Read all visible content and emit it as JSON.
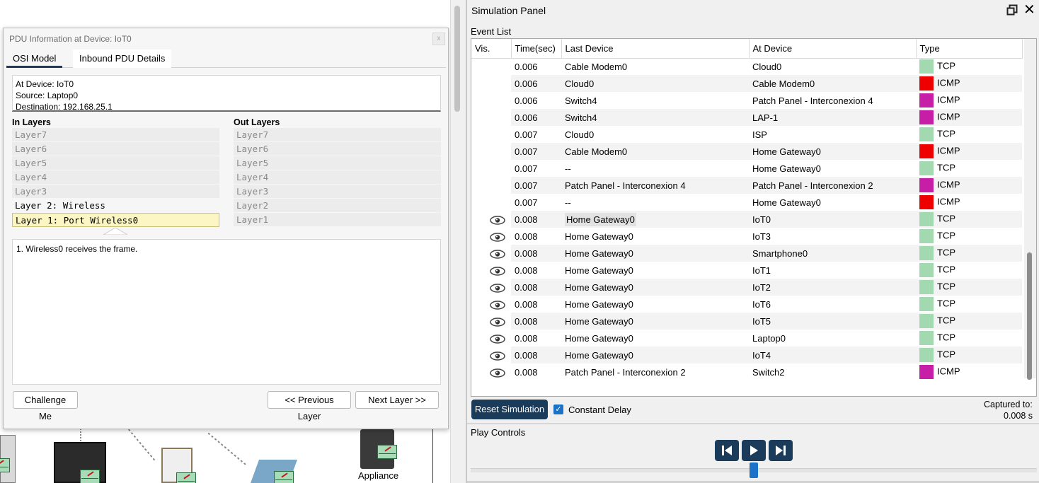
{
  "workspace": {
    "device_label": "Appliance"
  },
  "pdu": {
    "title": "PDU Information at Device: IoT0",
    "close_label": "x",
    "tabs": [
      {
        "label": "OSI Model",
        "active": true
      },
      {
        "label": "Inbound PDU Details",
        "active": false
      }
    ],
    "info": {
      "at_device": "At Device: IoT0",
      "source": "Source: Laptop0",
      "destination": "Destination: 192.168.25.1"
    },
    "in_layers_title": "In Layers",
    "out_layers_title": "Out Layers",
    "in_layers": [
      "Layer7",
      "Layer6",
      "Layer5",
      "Layer4",
      "Layer3",
      "Layer 2: Wireless",
      "Layer 1: Port Wireless0"
    ],
    "out_layers": [
      "Layer7",
      "Layer6",
      "Layer5",
      "Layer4",
      "Layer3",
      "Layer2",
      "Layer1"
    ],
    "description": "1. Wireless0 receives the frame.",
    "buttons": {
      "challenge": "Challenge Me",
      "previous": "<< Previous Layer",
      "next": "Next Layer >>"
    }
  },
  "sim": {
    "title": "Simulation Panel",
    "event_list_label": "Event List",
    "columns": [
      "Vis.",
      "Time(sec)",
      "Last Device",
      "At Device",
      "Type"
    ],
    "events": [
      {
        "vis": false,
        "time": "0.006",
        "last": "Cable Modem0",
        "at": "Cloud0",
        "type": "TCP",
        "color": "#a3d9b1"
      },
      {
        "vis": false,
        "time": "0.006",
        "last": "Cloud0",
        "at": "Cable Modem0",
        "type": "ICMP",
        "color": "#ee0000"
      },
      {
        "vis": false,
        "time": "0.006",
        "last": "Switch4",
        "at": "Patch Panel - Interconexion 4",
        "type": "ICMP",
        "color": "#c71ea8"
      },
      {
        "vis": false,
        "time": "0.006",
        "last": "Switch4",
        "at": "LAP-1",
        "type": "ICMP",
        "color": "#c71ea8"
      },
      {
        "vis": false,
        "time": "0.007",
        "last": "Cloud0",
        "at": "ISP",
        "type": "TCP",
        "color": "#a3d9b1"
      },
      {
        "vis": false,
        "time": "0.007",
        "last": "Cable Modem0",
        "at": "Home Gateway0",
        "type": "ICMP",
        "color": "#ee0000"
      },
      {
        "vis": false,
        "time": "0.007",
        "last": "--",
        "at": "Home Gateway0",
        "type": "TCP",
        "color": "#a3d9b1"
      },
      {
        "vis": false,
        "time": "0.007",
        "last": "Patch Panel - Interconexion 4",
        "at": "Patch Panel - Interconexion 2",
        "type": "ICMP",
        "color": "#c71ea8"
      },
      {
        "vis": false,
        "time": "0.007",
        "last": "--",
        "at": "Home Gateway0",
        "type": "ICMP",
        "color": "#ee0000"
      },
      {
        "vis": true,
        "time": "0.008",
        "last": "Home Gateway0",
        "at": "IoT0",
        "type": "TCP",
        "color": "#a3d9b1",
        "selected": true
      },
      {
        "vis": true,
        "time": "0.008",
        "last": "Home Gateway0",
        "at": "IoT3",
        "type": "TCP",
        "color": "#a3d9b1"
      },
      {
        "vis": true,
        "time": "0.008",
        "last": "Home Gateway0",
        "at": "Smartphone0",
        "type": "TCP",
        "color": "#a3d9b1"
      },
      {
        "vis": true,
        "time": "0.008",
        "last": "Home Gateway0",
        "at": "IoT1",
        "type": "TCP",
        "color": "#a3d9b1"
      },
      {
        "vis": true,
        "time": "0.008",
        "last": "Home Gateway0",
        "at": "IoT2",
        "type": "TCP",
        "color": "#a3d9b1"
      },
      {
        "vis": true,
        "time": "0.008",
        "last": "Home Gateway0",
        "at": "IoT6",
        "type": "TCP",
        "color": "#a3d9b1"
      },
      {
        "vis": true,
        "time": "0.008",
        "last": "Home Gateway0",
        "at": "IoT5",
        "type": "TCP",
        "color": "#a3d9b1"
      },
      {
        "vis": true,
        "time": "0.008",
        "last": "Home Gateway0",
        "at": "Laptop0",
        "type": "TCP",
        "color": "#a3d9b1"
      },
      {
        "vis": true,
        "time": "0.008",
        "last": "Home Gateway0",
        "at": "IoT4",
        "type": "TCP",
        "color": "#a3d9b1"
      },
      {
        "vis": true,
        "time": "0.008",
        "last": "Patch Panel - Interconexion 2",
        "at": "Switch2",
        "type": "ICMP",
        "color": "#c71ea8"
      }
    ],
    "reset_label": "Reset Simulation",
    "constant_delay_label": "Constant Delay",
    "constant_delay_checked": true,
    "captured_label": "Captured to:",
    "captured_value": "0.008 s",
    "play_controls_label": "Play Controls",
    "accent_color": "#1b3b5a"
  }
}
